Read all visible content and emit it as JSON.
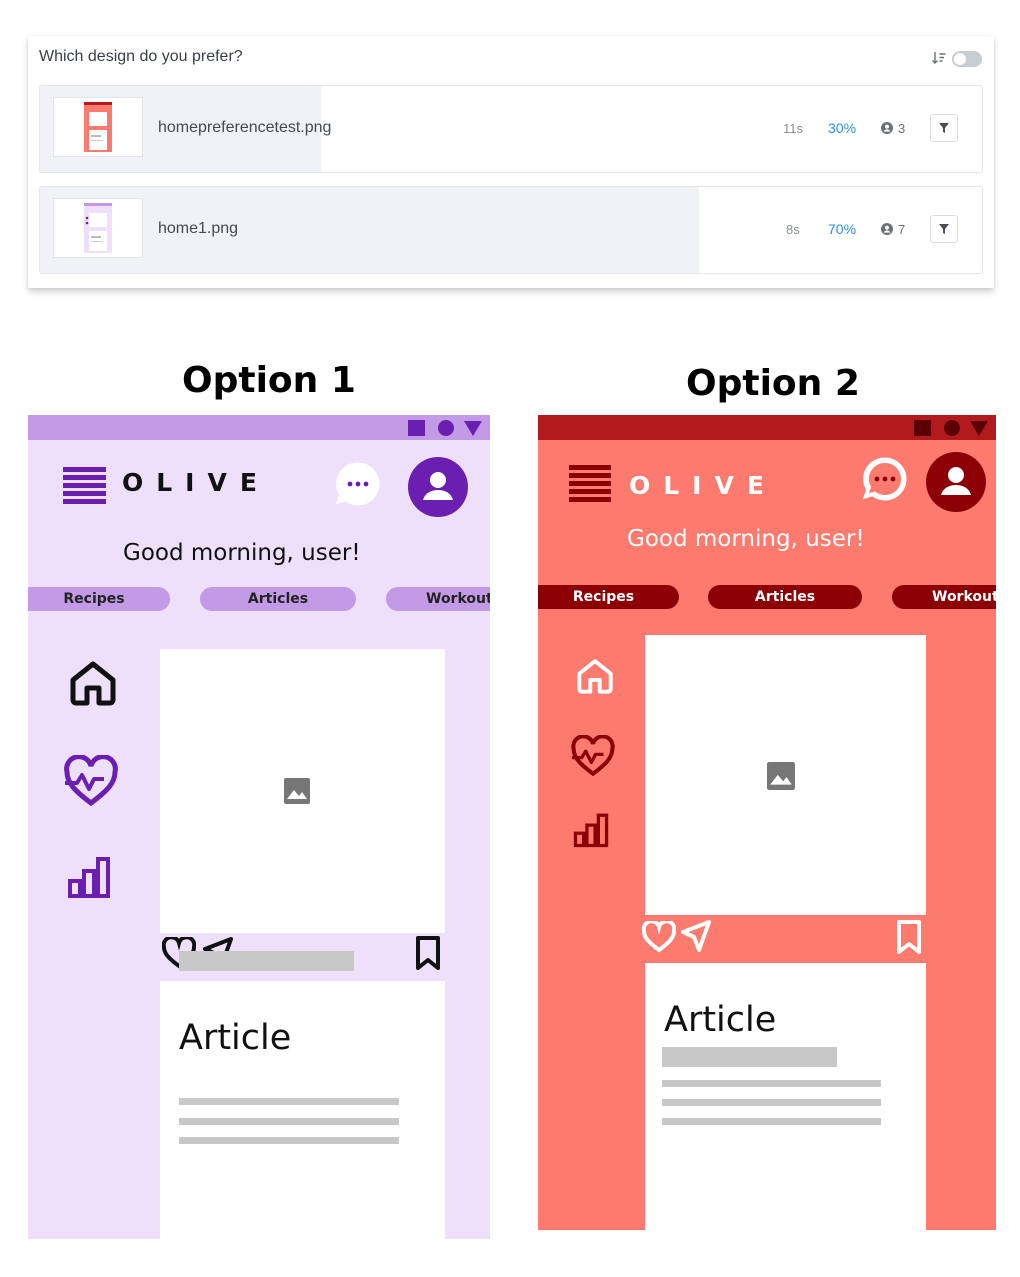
{
  "survey": {
    "question": "Which design do you prefer?",
    "rows": [
      {
        "filename": "homepreferencetest.png",
        "time": "11s",
        "percent": "30%",
        "percent_value": 30,
        "respondents": "3"
      },
      {
        "filename": "home1.png",
        "time": "8s",
        "percent": "70%",
        "percent_value": 70,
        "respondents": "7"
      }
    ]
  },
  "options": [
    {
      "title": "Option 1",
      "logo": "OLIVE",
      "greeting": "Good morning, user!",
      "tabs": [
        "Recipes",
        "Articles",
        "Workout"
      ],
      "article_title": "Article",
      "colors": {
        "status_bar": "#c29ae6",
        "header": "#eee0fa",
        "tab": "#c29ae6",
        "accent": "#6a1fb0",
        "body": "#eee0fa"
      }
    },
    {
      "title": "Option 2",
      "logo": "OLIVE",
      "greeting": "Good morning, user!",
      "tabs": [
        "Recipes",
        "Articles",
        "Workout"
      ],
      "article_title": "Article",
      "colors": {
        "status_bar": "#b21a1d",
        "header": "#fd7b6e",
        "tab": "#8c0005",
        "accent": "#8c0005",
        "body": "#fd7b6e"
      }
    }
  ]
}
